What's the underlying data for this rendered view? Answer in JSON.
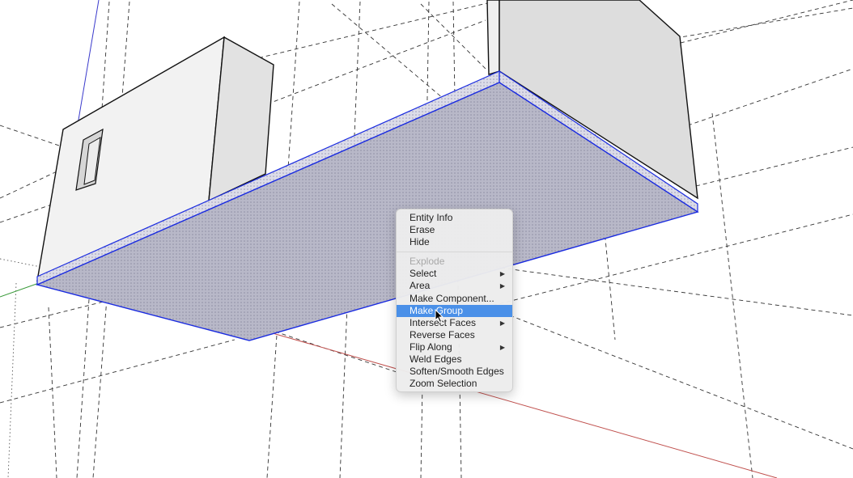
{
  "context_menu": {
    "items": [
      {
        "label": "Entity Info",
        "enabled": true
      },
      {
        "label": "Erase",
        "enabled": true
      },
      {
        "label": "Hide",
        "enabled": true
      },
      {
        "label": "Explode",
        "enabled": false
      },
      {
        "label": "Select",
        "enabled": true,
        "submenu": true
      },
      {
        "label": "Area",
        "enabled": true,
        "submenu": true
      },
      {
        "label": "Make Component...",
        "enabled": true
      },
      {
        "label": "Make Group",
        "enabled": true,
        "highlighted": true
      },
      {
        "label": "Intersect Faces",
        "enabled": true,
        "submenu": true
      },
      {
        "label": "Reverse Faces",
        "enabled": true
      },
      {
        "label": "Flip Along",
        "enabled": true,
        "submenu": true
      },
      {
        "label": "Weld Edges",
        "enabled": true
      },
      {
        "label": "Soften/Smooth Edges",
        "enabled": true
      },
      {
        "label": "Zoom Selection",
        "enabled": true
      }
    ],
    "submenu_arrow": "▶"
  },
  "colors": {
    "selection_edge": "#1a2be0",
    "selection_face": "#b8b8c8",
    "menu_highlight": "#4a90e8",
    "red_axis": "#c0504d",
    "green_axis": "#3a9a3a",
    "blue_axis": "#3a3acc"
  },
  "icons": {
    "submenu": "chevron-right-icon",
    "cursor": "arrow-pointer-icon"
  }
}
